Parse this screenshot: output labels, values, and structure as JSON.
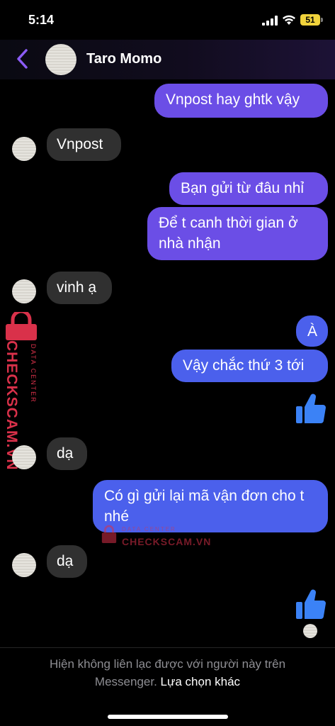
{
  "status_bar": {
    "time": "5:14",
    "battery": "51"
  },
  "header": {
    "contact_name": "Taro Momo"
  },
  "messages": [
    {
      "text": "Vnpost hay ghtk vậy"
    },
    {
      "text": "Vnpost"
    },
    {
      "text": "Bạn gửi từ đâu nhỉ"
    },
    {
      "text": "Để t canh thời gian ở nhà nhận"
    },
    {
      "text": "vinh ạ"
    },
    {
      "text": "À"
    },
    {
      "text": "Vậy chắc thứ 3 tới"
    },
    {
      "text": "dạ"
    },
    {
      "text": "Có gì gửi lại mã vận đơn cho t nhé"
    },
    {
      "text": "dạ"
    }
  ],
  "watermark": {
    "brand": "CHECKSCAM.VN",
    "sub": "DATA CENTER"
  },
  "footer": {
    "notice": "Hiện không liên lạc được với người này trên Messenger.",
    "link": "Lựa chọn khác"
  },
  "colors": {
    "outgoing_purple": "#6b4ee6",
    "outgoing_blue": "#4b60ec",
    "incoming": "#303030",
    "thumb": "#3b82f6",
    "watermark": "#d9314a"
  }
}
